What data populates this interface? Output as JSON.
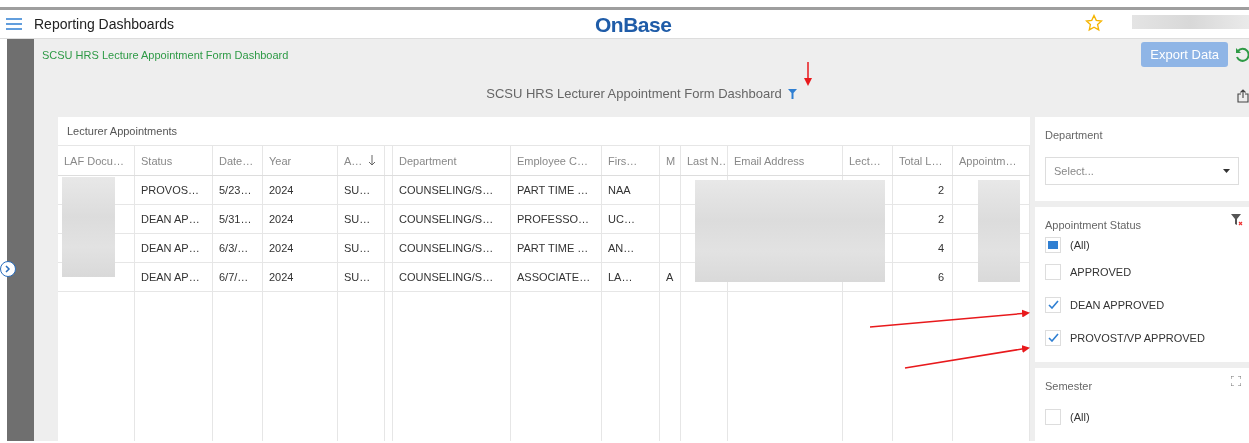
{
  "app_bar": {
    "title": "Reporting Dashboards",
    "brand": "OnBase"
  },
  "breadcrumb": "SCSU HRS Lecture Appointment Form Dashboard",
  "toolbar": {
    "export_button": "Export Data"
  },
  "dashboard": {
    "title": "SCSU HRS Lecturer Appointment Form Dashboard",
    "filtered": true
  },
  "table": {
    "title": "Lecturer Appointments",
    "columns": [
      {
        "label": "LAF Docu…"
      },
      {
        "label": "Status"
      },
      {
        "label": "Date…"
      },
      {
        "label": "Year"
      },
      {
        "label": "A…",
        "sorted_descending": true
      },
      {
        "label": "Department"
      },
      {
        "label": "Employee C…"
      },
      {
        "label": "Firs…"
      },
      {
        "label": "M"
      },
      {
        "label": "Last N…"
      },
      {
        "label": "Email Address"
      },
      {
        "label": "Lect…"
      },
      {
        "label": "Total L…"
      },
      {
        "label": "Appointm…"
      }
    ],
    "rows": [
      [
        null,
        "PROVOS…",
        "5/23…",
        "2024",
        "SU…",
        "COUNSELING/S…",
        "PART TIME …",
        "NAA",
        null,
        null,
        null,
        null,
        "2",
        null
      ],
      [
        null,
        "DEAN AP…",
        "5/31…",
        "2024",
        "SU…",
        "COUNSELING/S…",
        "PROFESSO…",
        "UC…",
        null,
        null,
        null,
        null,
        "2",
        null
      ],
      [
        null,
        "DEAN AP…",
        "6/3/…",
        "2024",
        "SU…",
        "COUNSELING/S…",
        "PART TIME …",
        "AN…",
        null,
        null,
        null,
        null,
        "4",
        null
      ],
      [
        null,
        "DEAN AP…",
        "6/7/…",
        "2024",
        "SU…",
        "COUNSELING/S…",
        "ASSOCIATE…",
        "LA…",
        "A",
        null,
        null,
        null,
        "6",
        null
      ]
    ]
  },
  "filters": [
    {
      "kind": "dropdown",
      "title": "Department",
      "placeholder": "Select..."
    },
    {
      "kind": "checklist",
      "title": "Appointment Status",
      "clearable": true,
      "items": [
        {
          "label": "(All)",
          "checked": false,
          "partial": true
        },
        {
          "label": "APPROVED",
          "checked": false
        },
        {
          "label": "DEAN APPROVED",
          "checked": true
        },
        {
          "label": "PROVOST/VP APPROVED",
          "checked": true
        }
      ]
    },
    {
      "kind": "checklist",
      "title": "Semester",
      "clearable": false,
      "items": [
        {
          "label": "(All)",
          "checked": false
        }
      ]
    }
  ]
}
